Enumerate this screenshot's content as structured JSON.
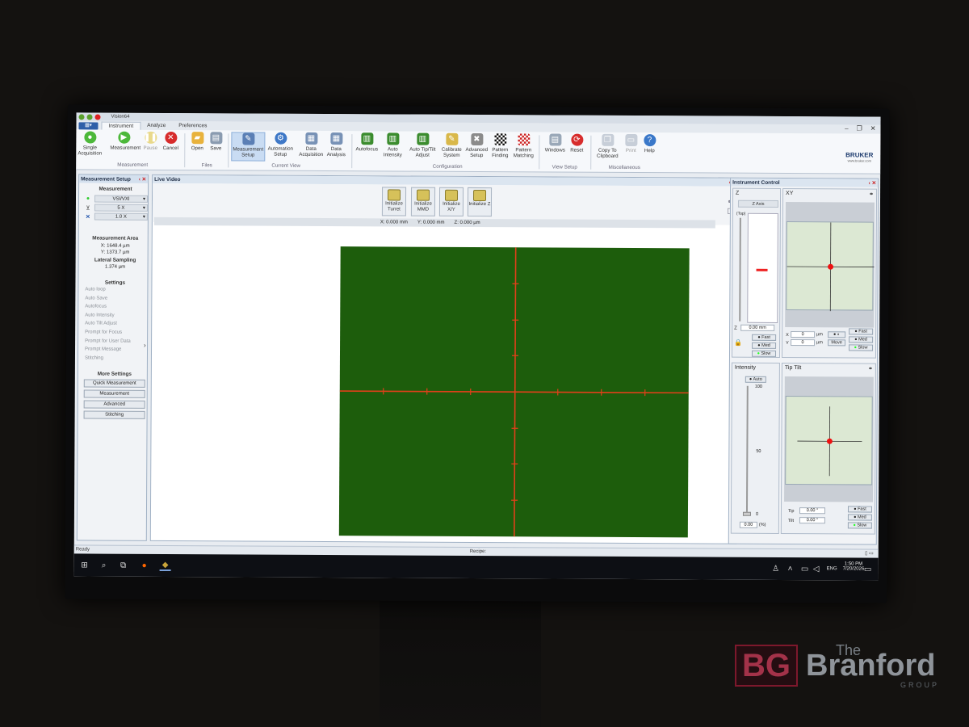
{
  "window": {
    "title": "Vision64",
    "app_button": "▦▾"
  },
  "menu_tabs": [
    "Instrument",
    "Analyze",
    "Preferences"
  ],
  "ribbon": {
    "single_acquisition": "Single Acquisition",
    "measurement": "Measurement",
    "pause": "Pause",
    "cancel": "Cancel",
    "open": "Open",
    "save": "Save",
    "measurement_setup": "Measurement Setup",
    "automation_setup": "Automation Setup",
    "data_acquisition": "Data Acquisition",
    "data_analysis": "Data Analysis",
    "autofocus": "Autofocus",
    "auto_intensity": "Auto Intensity",
    "auto_tip_tilt": "Auto Tip/Tilt Adjust",
    "calibrate_system": "Calibrate System",
    "advanced_setup": "Advanced Setup",
    "pattern_finding": "Pattern Finding",
    "pattern_matching": "Pattern Matching",
    "windows": "Windows",
    "reset": "Reset",
    "copy_clipboard": "Copy To Clipboard",
    "print": "Print",
    "help": "Help",
    "groups": {
      "measurement": "Measurement",
      "files": "Files",
      "current_view": "Current View",
      "configuration": "Configuration",
      "view_setup": "View Setup",
      "miscellaneous": "Miscellaneous"
    },
    "brand": "BRUKER",
    "brand_url": "www.bruker.com"
  },
  "left_panel": {
    "title": "Measurement Setup",
    "measurement_header": "Measurement",
    "mode": "VSI/VXI",
    "objective": "5 X",
    "zoom": "1.0 X",
    "area_header": "Measurement Area",
    "area_x": "X: 1648.4 µm",
    "area_y": "Y: 1373.7 µm",
    "sampling_header": "Lateral Sampling",
    "sampling_value": "1.374 µm",
    "settings_header": "Settings",
    "settings": [
      "Auto loop",
      "Auto Save",
      "Autofocus",
      "Auto Intensity",
      "Auto Tilt Adjust",
      "Prompt for Focus",
      "Prompt for User Data",
      "Prompt Message",
      "Stitching"
    ],
    "more_header": "More Settings",
    "more_buttons": [
      "Quick Measurement",
      "Measurement",
      "Advanced",
      "Stitching"
    ]
  },
  "live_video": {
    "title": "Live Video",
    "init_buttons": [
      "Initialize Turret",
      "Initialize MMD",
      "Initialize X/Y",
      "Initialize Z"
    ],
    "coord_x": "X:  0.000 mm",
    "coord_y": "Y:  0.000 mm",
    "coord_z": "Z:  0.000 µm"
  },
  "instrument_control": {
    "title": "Instrument Control",
    "z_title": "Z",
    "z_axis": "Z Axis",
    "z_top": "(Top)",
    "z_value": "0.00 mm",
    "z_label": "Z",
    "speed": [
      "Fast",
      "Med",
      "Slow"
    ],
    "xy_title": "XY",
    "x_label": "X",
    "y_label": "Y",
    "x_value": "0",
    "y_value": "0",
    "xy_unit": "µm",
    "move": "Move",
    "intensity_title": "Intensity",
    "auto": "Auto",
    "intensity_ticks": [
      "100",
      "50",
      "0"
    ],
    "intensity_value": "0.00",
    "intensity_unit": "(%)",
    "tiptilt_title": "Tip Tilt",
    "tip_label": "Tip",
    "tilt_label": "Tilt",
    "tip_value": "0.00 °",
    "tilt_value": "0.00 °"
  },
  "status": {
    "left": "Ready",
    "recipe": "Recipe:"
  },
  "taskbar": {
    "lang": "ENG",
    "time": "1:50 PM",
    "date": "7/20/2026"
  },
  "watermark": {
    "the": "The",
    "name": "Branford",
    "group": "GROUP",
    "logo": "BG"
  }
}
